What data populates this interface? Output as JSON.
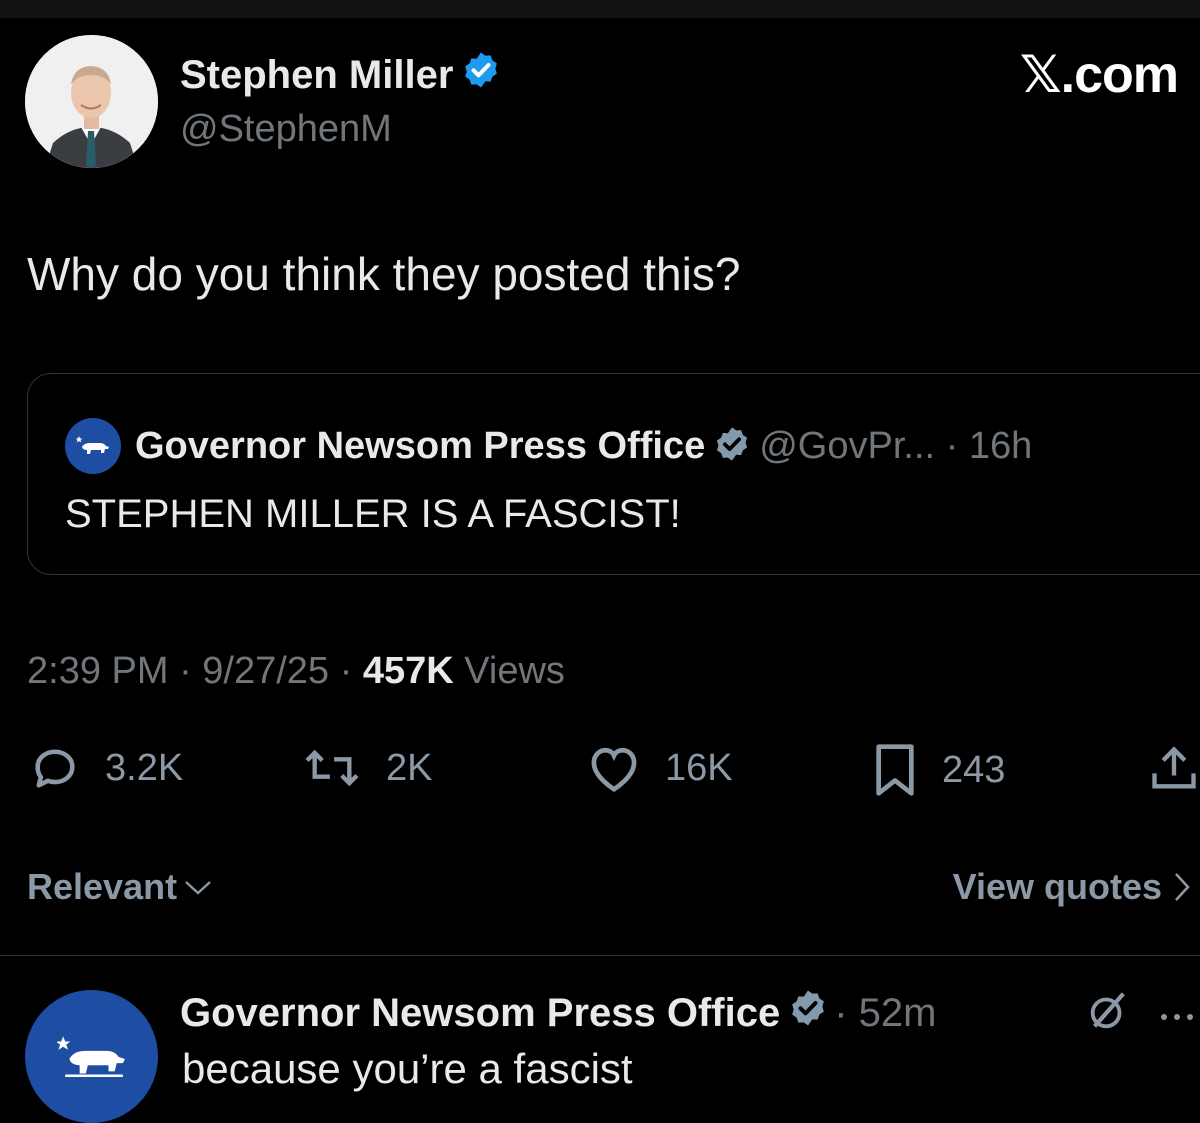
{
  "app": {
    "brand": "𝕏.com"
  },
  "post": {
    "author_name": "Stephen Miller",
    "author_handle": "@StephenM",
    "text": "Why do you think they posted this?",
    "timestamp": "2:39 PM · 9/27/25 · ",
    "views_count": "457K",
    "views_label": " Views",
    "stats": {
      "replies": "3.2K",
      "reposts": "2K",
      "likes": "16K",
      "bookmarks": "243"
    }
  },
  "quote": {
    "author_name": "Governor Newsom Press Office",
    "handle_time": "@GovPr... · 16h",
    "text": "STEPHEN MILLER IS A FASCIST!"
  },
  "sort": {
    "label": "Relevant",
    "view_quotes": "View quotes"
  },
  "reply": {
    "author_name": "Governor Newsom Press Office",
    "time": "· 52m",
    "text": "because you’re a fascist"
  },
  "colors": {
    "background": "#000000",
    "text": "#e7e9ea",
    "muted": "#71767b",
    "verified_blue": "#1d9bf0",
    "verified_gray": "#829aab",
    "newsom_blue": "#1d4ea3"
  }
}
